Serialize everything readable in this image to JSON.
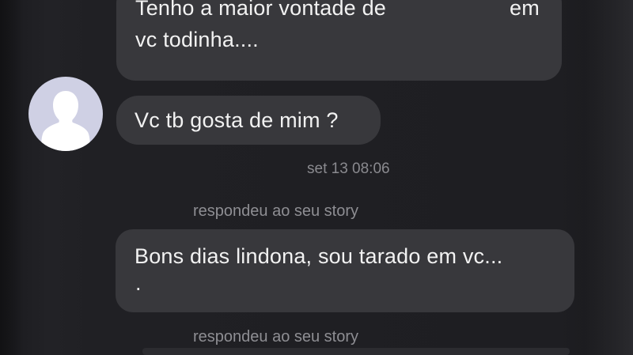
{
  "chat": {
    "messages": [
      {
        "lines": [
          "Tenho a maior vontade de",
          "em",
          "vc todinha...."
        ]
      },
      {
        "lines": [
          "Vc tb gosta de mim ?"
        ]
      },
      {
        "lines": [
          "Bons dias lindona,  sou tarado em vc...",
          "."
        ]
      }
    ],
    "timestamp": "set 13 08:06",
    "story_replies": [
      "respondeu ao seu story",
      "respondeu ao seu story"
    ]
  },
  "avatar": {
    "icon": "default-user-avatar-icon",
    "background": "#cfd0e4",
    "silhouette": "#ffffff"
  },
  "colors": {
    "background": "#1e1e22",
    "bubble": "#38383c",
    "text": "#f2f2f2",
    "meta_text": "#8e8e93"
  }
}
